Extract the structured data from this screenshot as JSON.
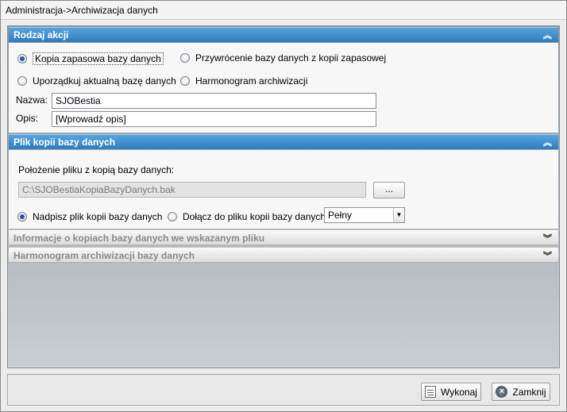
{
  "window": {
    "title": "Administracja->Archiwizacja danych"
  },
  "section_action": {
    "header": "Rodzaj akcji",
    "chevron": "⌃",
    "radios": {
      "backup": "Kopia zapasowa bazy danych",
      "restore": "Przywrócenie bazy danych z kopii zapasowej",
      "organize": "Uporządkuj aktualną bazę danych",
      "schedule": "Harmonogram archiwizacji"
    },
    "selected": "backup",
    "name_label": "Nazwa:",
    "name_value": "SJOBestia",
    "desc_label": "Opis:",
    "desc_value": "[Wprowadź opis]"
  },
  "section_file": {
    "header": "Plik kopii bazy danych",
    "location_label": "Położenie pliku z kopią bazy danych:",
    "path_value": "C:\\SJOBestiaKopiaBazyDanych.bak",
    "browse_label": "...",
    "radios": {
      "overwrite": "Nadpisz plik kopii bazy danych",
      "append": "Dołącz do pliku kopii bazy danych"
    },
    "selected": "overwrite",
    "backup_type": "Pełny"
  },
  "section_info": {
    "header": "Informacje o kopiach bazy danych we wskazanym pliku"
  },
  "section_schedule": {
    "header": "Harmonogram archiwizacji bazy danych"
  },
  "footer": {
    "execute_label": "Wykonaj",
    "close_label": "Zamknij"
  },
  "icons": {
    "expand": "chevrons-down-icon",
    "collapse": "chevrons-up-icon",
    "execute": "document-icon",
    "close": "close-circle-icon"
  }
}
